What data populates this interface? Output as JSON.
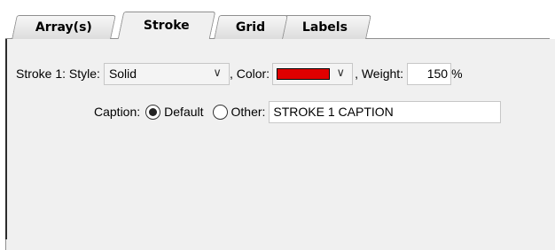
{
  "tabs": [
    {
      "label": "Array(s)"
    },
    {
      "label": "Stroke",
      "active": true
    },
    {
      "label": "Grid"
    },
    {
      "label": "Labels"
    }
  ],
  "stroke": {
    "prefix_label": "Stroke 1: Style:",
    "style_value": "Solid",
    "color_label": ", Color:",
    "color_hex": "#e00000",
    "weight_label": ", Weight:",
    "weight_value": "150",
    "weight_unit": "%"
  },
  "caption": {
    "label": "Caption:",
    "default_label": "Default",
    "default_selected": true,
    "other_label": "Other:",
    "other_value": "STROKE 1 CAPTION"
  },
  "icons": [
    "chevron-down-icon",
    "radio-selected-icon",
    "radio-unselected-icon"
  ]
}
